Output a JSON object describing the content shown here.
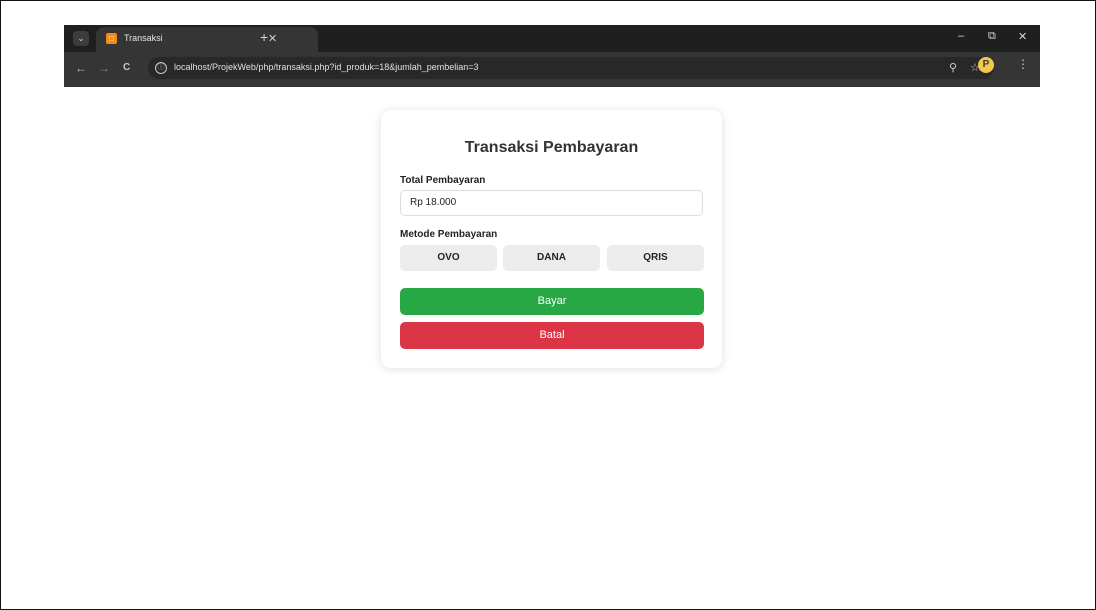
{
  "browser": {
    "tab_title": "Transaksi",
    "favicon_letter": "□",
    "tab_search_icon": "⌄",
    "tab_close_icon": "✕",
    "new_tab_icon": "+",
    "window_controls": {
      "minimize": "–",
      "restore": "⧉",
      "close": "✕"
    },
    "nav": {
      "back": "←",
      "forward": "→",
      "reload": "C"
    },
    "url": "localhost/ProjekWeb/php/transaksi.php?id_produk=18&jumlah_pembelian=3",
    "icons": {
      "site_info": "ⓘ",
      "zoom": "⚲",
      "bookmark": "☆",
      "profile": "P",
      "menu": "⋮"
    }
  },
  "form": {
    "title": "Transaksi Pembayaran",
    "total_label": "Total Pembayaran",
    "total_value": "Rp 18.000",
    "method_label": "Metode Pembayaran",
    "methods": [
      "OVO",
      "DANA",
      "QRIS"
    ],
    "pay_label": "Bayar",
    "cancel_label": "Batal"
  },
  "colors": {
    "pay": "#28a745",
    "cancel": "#dc3545",
    "method_bg": "#ececec"
  }
}
